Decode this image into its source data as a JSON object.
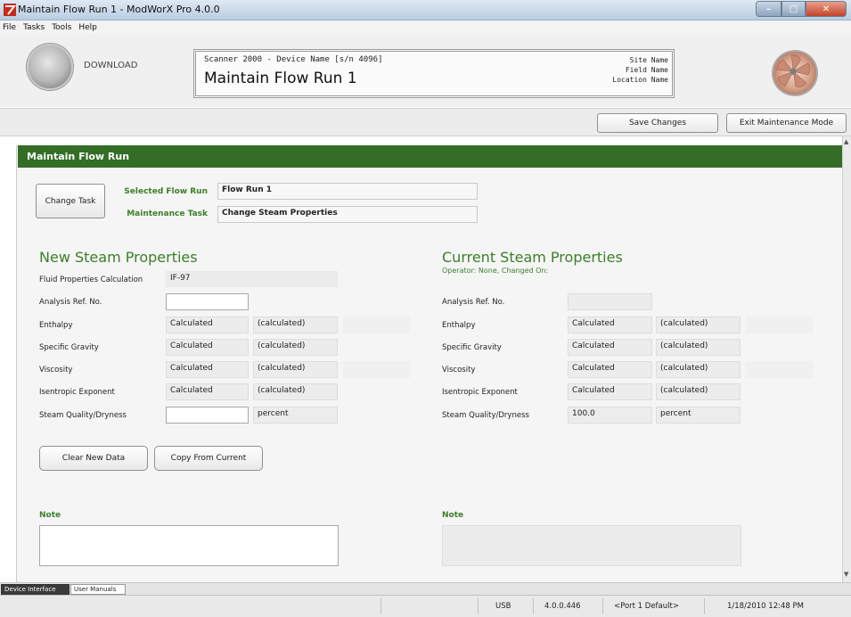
{
  "window": {
    "title": "Maintain Flow Run 1 - ModWorX Pro 4.0.0",
    "min_glyph": "–",
    "max_glyph": "□",
    "close_glyph": "✕"
  },
  "menu": [
    "File",
    "Tasks",
    "Tools",
    "Help"
  ],
  "header": {
    "download_label": "DOWNLOAD",
    "device_line": "Scanner 2000 - Device Name [s/n 4096]",
    "main_title": "Maintain Flow Run 1",
    "site_name": "Site Name",
    "field_name": "Field Name",
    "location_name": "Location Name"
  },
  "toolbar": {
    "save_label": "Save Changes",
    "exit_label": "Exit Maintenance Mode"
  },
  "section": {
    "title": "Maintain Flow Run",
    "change_task_label": "Change Task",
    "selected_flow_run_label": "Selected Flow Run",
    "selected_flow_run_value": "Flow Run 1",
    "maintenance_task_label": "Maintenance Task",
    "maintenance_task_value": "Change Steam Properties"
  },
  "new_props": {
    "title": "New Steam Properties",
    "fluid_calc_label": "Fluid Properties Calculation",
    "fluid_calc_value": "IF-97",
    "analysis_label": "Analysis Ref. No.",
    "analysis_value": "",
    "rows": [
      {
        "label": "Enthalpy",
        "value": "Calculated",
        "unit": "(calculated)"
      },
      {
        "label": "Specific Gravity",
        "value": "Calculated",
        "unit": "(calculated)"
      },
      {
        "label": "Viscosity",
        "value": "Calculated",
        "unit": "(calculated)"
      },
      {
        "label": "Isentropic Exponent",
        "value": "Calculated",
        "unit": "(calculated)"
      }
    ],
    "quality_label": "Steam Quality/Dryness",
    "quality_value": "",
    "quality_unit": "percent",
    "clear_label": "Clear New Data",
    "copy_label": "Copy From Current",
    "note_label": "Note",
    "note_value": ""
  },
  "current_props": {
    "title": "Current Steam Properties",
    "operator_line": "Operator: None, Changed On:",
    "analysis_label": "Analysis Ref. No.",
    "analysis_value": "",
    "rows": [
      {
        "label": "Enthalpy",
        "value": "Calculated",
        "unit": "(calculated)"
      },
      {
        "label": "Specific Gravity",
        "value": "Calculated",
        "unit": "(calculated)"
      },
      {
        "label": "Viscosity",
        "value": "Calculated",
        "unit": "(calculated)"
      },
      {
        "label": "Isentropic Exponent",
        "value": "Calculated",
        "unit": "(calculated)"
      }
    ],
    "quality_label": "Steam Quality/Dryness",
    "quality_value": "100.0",
    "quality_unit": "percent",
    "note_label": "Note",
    "note_value": ""
  },
  "bottom_tabs": [
    "Device Interface",
    "User Manuals"
  ],
  "status": {
    "connection": "USB",
    "version": "4.0.0.446",
    "port": "<Port 1 Default>",
    "datetime": "1/18/2010 12:48 PM"
  },
  "colors": {
    "section_green": "#336d26",
    "label_green": "#3c7e29"
  }
}
